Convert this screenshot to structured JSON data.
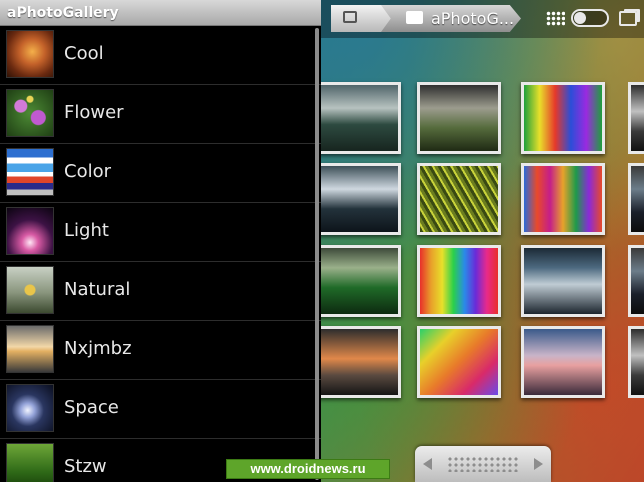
{
  "left_panel": {
    "title": "aPhotoGallery",
    "albums": [
      {
        "label": "Cool"
      },
      {
        "label": "Flower"
      },
      {
        "label": "Color"
      },
      {
        "label": "Light"
      },
      {
        "label": "Natural"
      },
      {
        "label": "Nxjmbz"
      },
      {
        "label": "Space"
      },
      {
        "label": "Stzw"
      }
    ]
  },
  "right_panel": {
    "album_title": "aPhotoG...",
    "photo_count_visible": 14
  },
  "watermark": {
    "text": "www.droidnews.ru"
  },
  "colors": {
    "title_bar": "#b8b8b8",
    "list_background": "#000000",
    "list_text": "#e8e8e8",
    "photo_frame": "#e9e9e9",
    "watermark_bg": "#5ea52a"
  },
  "icons": [
    "gallery-icon",
    "folder-icon",
    "grid-view-icon",
    "view-toggle-icon",
    "slideshow-icon",
    "pager-prev-icon",
    "pager-next-icon"
  ]
}
